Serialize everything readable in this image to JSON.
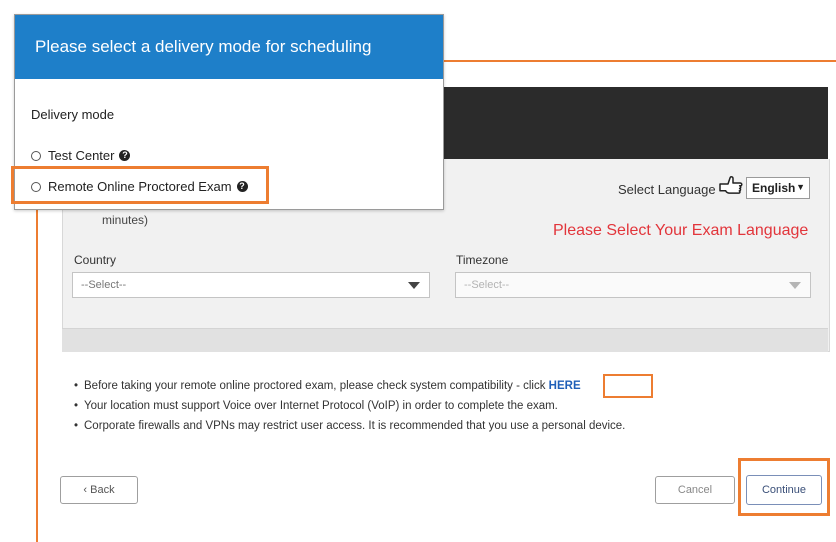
{
  "colors": {
    "accent_orange": "#ed7d31",
    "modal_header_blue": "#1e7fc9",
    "prompt_red": "#e2353b",
    "link_blue": "#1f5fb8",
    "dark_band": "#2b2b2b"
  },
  "modal": {
    "title": "Please select a delivery mode for scheduling",
    "section_label": "Delivery mode",
    "options": [
      {
        "label": "Test Center",
        "selected": false,
        "icon": "question-circle-icon"
      },
      {
        "label": "Remote Online Proctored Exam",
        "selected": false,
        "icon": "question-circle-icon"
      }
    ]
  },
  "page": {
    "select_language_label": "Select Language",
    "hand_icon": "pointing-hand-icon",
    "language_value": "English",
    "duration_fragment": "minutes)",
    "exam_language_prompt": "Please Select Your Exam Language",
    "country": {
      "label": "Country",
      "value": "--Select--"
    },
    "timezone": {
      "label": "Timezone",
      "value": "--Select--"
    },
    "notes": [
      {
        "text": "Before taking your remote online proctored exam, please check system compatibility - click ",
        "link": "HERE"
      },
      {
        "text": "Your location must support Voice over Internet Protocol (VoIP) in order to complete the exam."
      },
      {
        "text": "Corporate firewalls and VPNs may restrict user access. It is recommended that you use a personal device."
      }
    ],
    "buttons": {
      "back": "‹ Back",
      "cancel": "Cancel",
      "continue": "Continue"
    }
  }
}
